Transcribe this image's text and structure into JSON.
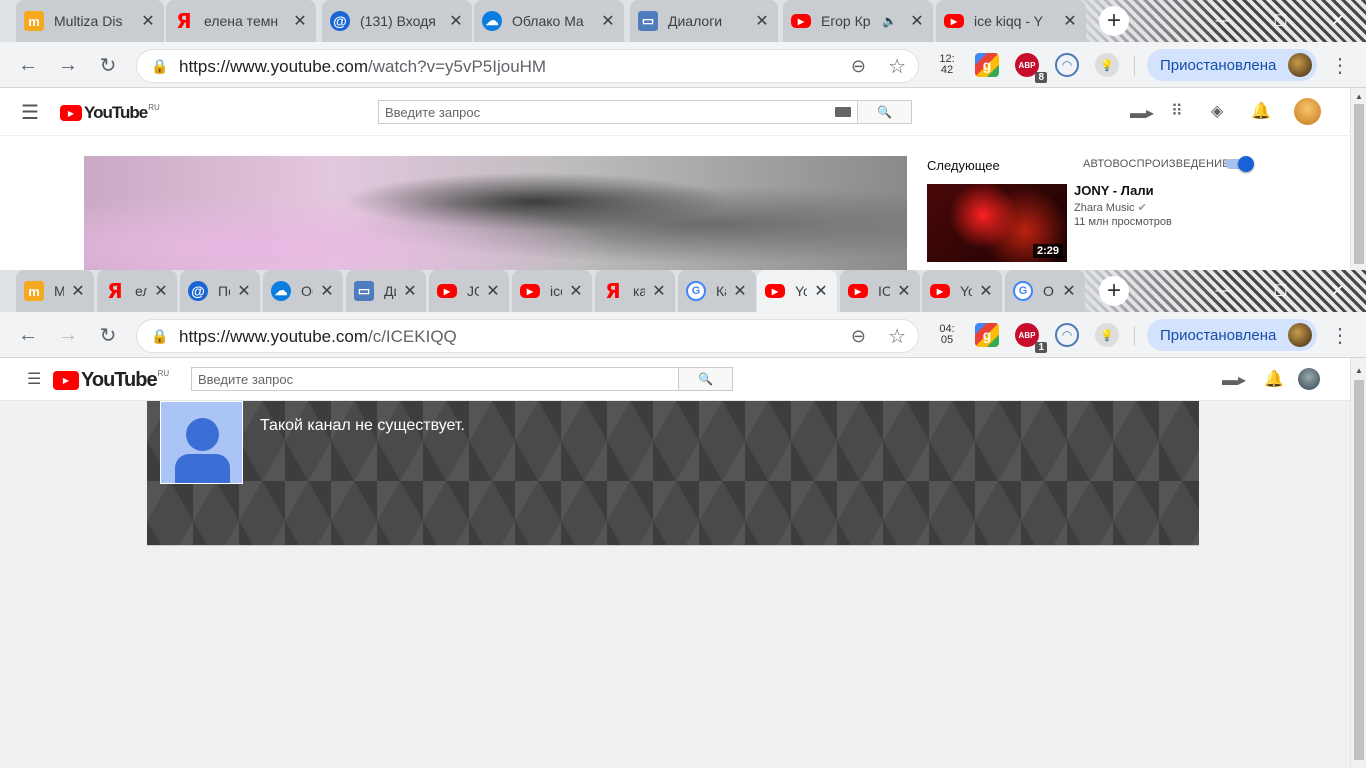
{
  "window1": {
    "tabs": [
      {
        "title": "Multiza Dis",
        "icon": "multiza-icon",
        "glyph": "m"
      },
      {
        "title": "елена темн",
        "icon": "yandex-icon",
        "glyph": "Я"
      },
      {
        "title": "(131) Входя",
        "icon": "mail-icon",
        "glyph": "@"
      },
      {
        "title": "Облако Ma",
        "icon": "cloud-icon",
        "glyph": "☁"
      },
      {
        "title": "Диалоги",
        "icon": "dialogs-icon",
        "glyph": "▭"
      },
      {
        "title": "Егор Кр",
        "icon": "youtube-icon",
        "glyph": "▶",
        "audio": "🔈"
      },
      {
        "title": "ice kiqq - Y",
        "icon": "youtube-icon",
        "glyph": "▶"
      }
    ],
    "url_host": "https://www.youtube.com",
    "url_path": "/watch?v=y5vP5IjouHM",
    "clock_ext": [
      "12:",
      "42"
    ],
    "abp_badge": "8",
    "profile_label": "Приостановлена",
    "search_placeholder": "Введите запрос",
    "logo_word": "YouTube",
    "logo_region": "RU",
    "up_next": "Следующее",
    "autoplay": "АВТОВОСПРОИЗВЕДЕНИЕ",
    "next_video": {
      "title": "JONY - Лали",
      "channel": "Zhara Music",
      "views": "11 млн просмотров",
      "duration": "2:29"
    }
  },
  "window2": {
    "tabs": [
      {
        "title": "Multi",
        "icon": "multiza-icon",
        "glyph": "m"
      },
      {
        "title": "елен",
        "icon": "yandex-icon",
        "glyph": "Я"
      },
      {
        "title": "Почт",
        "icon": "mail-icon",
        "glyph": "@"
      },
      {
        "title": "Обла",
        "icon": "cloud-icon",
        "glyph": "☁"
      },
      {
        "title": "Диал",
        "icon": "dialogs-icon",
        "glyph": "▭"
      },
      {
        "title": "JONY",
        "icon": "youtube-icon",
        "glyph": "▶"
      },
      {
        "title": "ice ki",
        "icon": "youtube-icon",
        "glyph": "▶"
      },
      {
        "title": "как и",
        "icon": "yandex-icon",
        "glyph": "Я"
      },
      {
        "title": "Как и",
        "icon": "google-icon",
        "glyph": "G"
      },
      {
        "title": "Yo",
        "icon": "youtube-icon",
        "glyph": "▶",
        "active": true
      },
      {
        "title": "ICE K",
        "icon": "youtube-icon",
        "glyph": "▶"
      },
      {
        "title": "YouT",
        "icon": "youtube-icon",
        "glyph": "▶"
      },
      {
        "title": "О сеі",
        "icon": "google-icon",
        "glyph": "G"
      }
    ],
    "url_host": "https://www.youtube.com",
    "url_path": "/c/ICEKIQQ",
    "clock_ext": [
      "04:",
      "05"
    ],
    "abp_badge": "1",
    "profile_label": "Приостановлена",
    "search_placeholder": "Введите запрос",
    "logo_word": "YouTube",
    "logo_region": "RU",
    "channel_message": "Такой канал не существует."
  },
  "colors": {
    "accent": "#1a60d6",
    "youtube_red": "#ff0000",
    "banner": "#4a4a4a"
  }
}
